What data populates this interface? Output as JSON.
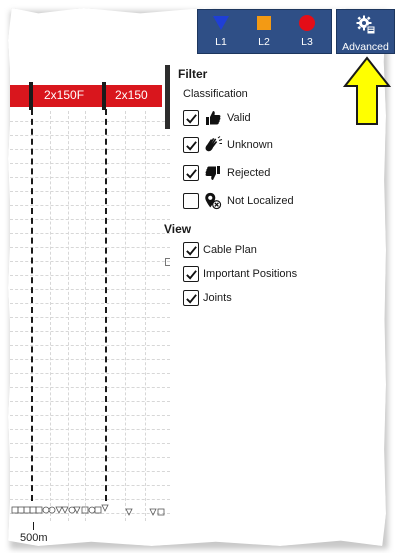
{
  "toolbar": {
    "layers": [
      {
        "label": "L1",
        "icon": "blue-triangle-icon",
        "color": "#1f3fd6"
      },
      {
        "label": "L2",
        "icon": "orange-square-icon",
        "color": "#f39a14"
      },
      {
        "label": "L3",
        "icon": "red-circle-icon",
        "color": "#e40d17"
      }
    ],
    "advanced_label": "Advanced",
    "advanced_icon": "gear-settings-icon"
  },
  "chart": {
    "cable_labels": [
      "2x150F",
      "2x150"
    ],
    "distance_label": "500m",
    "cable_color": "#d9161d"
  },
  "filter": {
    "title": "Filter",
    "classification_label": "Classification",
    "items": [
      {
        "label": "Valid",
        "checked": true,
        "icon": "thumbs-up-icon"
      },
      {
        "label": "Unknown",
        "checked": true,
        "icon": "waving-hand-icon"
      },
      {
        "label": "Rejected",
        "checked": true,
        "icon": "thumbs-down-icon"
      },
      {
        "label": "Not Localized",
        "checked": false,
        "icon": "location-pin-x-icon"
      }
    ]
  },
  "view": {
    "title": "View",
    "items": [
      {
        "label": "Cable Plan",
        "checked": true
      },
      {
        "label": "Important Positions",
        "checked": true
      },
      {
        "label": "Joints",
        "checked": true
      }
    ]
  },
  "annotation": {
    "arrow_color": "#ffff00"
  }
}
